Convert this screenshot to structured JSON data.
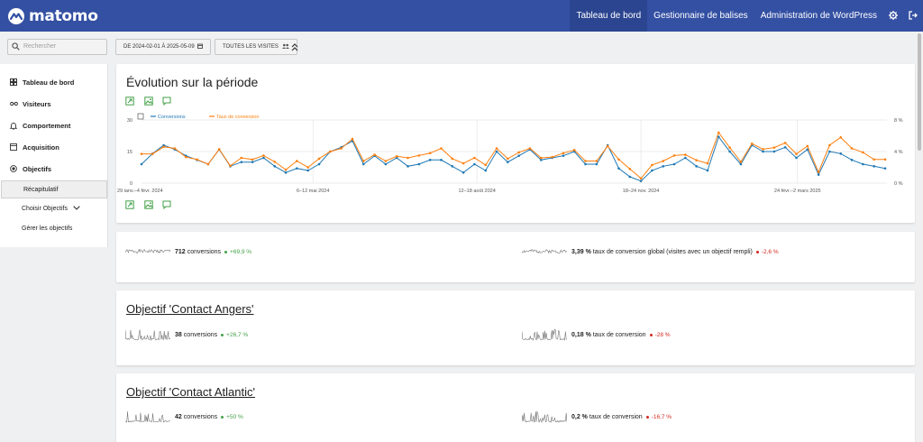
{
  "app": {
    "logo_text": "matomo",
    "nav": [
      "Tableau de bord",
      "Gestionnaire de balises",
      "Administration de WordPress"
    ],
    "active_nav": 0,
    "nav_icons": [
      "gear-icon",
      "logout-icon"
    ]
  },
  "controls": {
    "search_placeholder": "Rechercher",
    "date_range": "DE 2024-02-01 À 2025-05-09",
    "segment": "TOUTES LES VISITES"
  },
  "sidebar": {
    "items": [
      {
        "label": "Tableau de bord",
        "icon": "dashboard-icon"
      },
      {
        "label": "Visiteurs",
        "icon": "visitors-icon"
      },
      {
        "label": "Comportement",
        "icon": "bell-icon"
      },
      {
        "label": "Acquisition",
        "icon": "acquisition-icon"
      },
      {
        "label": "Objectifs",
        "icon": "target-icon"
      }
    ],
    "sub_items": [
      "Récapitulatif",
      "Choisir Objectifs",
      "Gérer les objectifs"
    ],
    "selected_sub": 0
  },
  "evolution": {
    "title": "Évolution sur la période"
  },
  "chart_data": {
    "type": "line",
    "x_labels": [
      "29 janv.–4 févr. 2024",
      "6–12 mai 2024",
      "12–18 août 2024",
      "18–24 nov. 2024",
      "24 févr.–2 mars 2025"
    ],
    "y_left": {
      "ticks": [
        "0",
        "15",
        "30"
      ],
      "min": 0,
      "max": 30
    },
    "y_right": {
      "ticks": [
        "0 %",
        "4 %",
        "8 %"
      ],
      "min": 0,
      "max": 8
    },
    "series": [
      {
        "name": "Conversions",
        "color": "#1f78b4",
        "axis": "left",
        "values": [
          9,
          14,
          18,
          16,
          13,
          11,
          9,
          16,
          8,
          10,
          10,
          12,
          8,
          5,
          7,
          6,
          9,
          15,
          17,
          20,
          9,
          13,
          9,
          12,
          8,
          9,
          11,
          11,
          8,
          5,
          9,
          6,
          15,
          10,
          13,
          16,
          11,
          12,
          13,
          15,
          9,
          9,
          18,
          7,
          3,
          1,
          6,
          8,
          9,
          12,
          8,
          6,
          22,
          15,
          9,
          18,
          15,
          15,
          17,
          12,
          16,
          4,
          15,
          14,
          11,
          9,
          8,
          7
        ]
      },
      {
        "name": "Taux de conversion",
        "color": "#ff7f0e",
        "axis": "right",
        "values": [
          3.7,
          3.7,
          4.6,
          4.4,
          3.3,
          3.0,
          2.4,
          4.3,
          2.2,
          3.2,
          3.0,
          3.5,
          2.7,
          1.7,
          2.8,
          2.0,
          3.1,
          4.0,
          4.4,
          5.6,
          2.8,
          3.6,
          2.8,
          3.4,
          3.2,
          3.5,
          3.8,
          4.4,
          3.1,
          2.5,
          3.2,
          2.3,
          4.4,
          3.1,
          3.9,
          4.4,
          3.2,
          3.3,
          3.8,
          4.2,
          2.8,
          2.8,
          4.7,
          3.0,
          1.8,
          0.6,
          2.3,
          2.8,
          3.5,
          3.6,
          2.9,
          2.5,
          6.4,
          4.5,
          2.7,
          5.0,
          4.3,
          4.5,
          5.1,
          3.7,
          4.7,
          1.4,
          4.8,
          5.8,
          4.4,
          3.9,
          3.0,
          3.0
        ]
      }
    ]
  },
  "summary": [
    {
      "value": "712",
      "label": "conversions",
      "trend": "+69,9 %",
      "dir": "up"
    },
    {
      "value": "3,39 %",
      "label": "taux de conversion global (visites avec un objectif rempli)",
      "trend": "-2,6 %",
      "dir": "down"
    }
  ],
  "goals": [
    {
      "title": "Objectif 'Contact Angers'",
      "metrics": [
        {
          "value": "38",
          "label": "conversions",
          "trend": "+26,7 %",
          "dir": "up"
        },
        {
          "value": "0,18 %",
          "label": "taux de conversion",
          "trend": "-28 %",
          "dir": "down"
        }
      ]
    },
    {
      "title": "Objectif 'Contact Atlantic'",
      "metrics": [
        {
          "value": "42",
          "label": "conversions",
          "trend": "+50 %",
          "dir": "up"
        },
        {
          "value": "0,2 %",
          "label": "taux de conversion",
          "trend": "-16,7 %",
          "dir": "down"
        }
      ]
    }
  ]
}
